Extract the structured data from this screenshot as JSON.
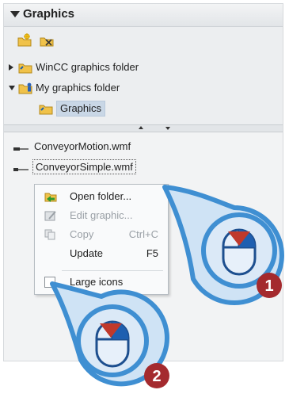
{
  "panel": {
    "title": "Graphics"
  },
  "toolbar": [
    {
      "icon": "new-folder-icon"
    },
    {
      "icon": "delete-folder-icon"
    }
  ],
  "tree": [
    {
      "label": "WinCC graphics folder",
      "expanded": false
    },
    {
      "label": "My graphics folder",
      "expanded": true
    },
    {
      "label": "Graphics",
      "selected": true
    }
  ],
  "files": [
    {
      "name": "ConveyorMotion.wmf"
    },
    {
      "name": "ConveyorSimple.wmf"
    }
  ],
  "context_menu": {
    "items": [
      {
        "label": "Open folder...",
        "shortcut": "",
        "enabled": true,
        "icon": "open-folder-icon"
      },
      {
        "label": "Edit graphic...",
        "shortcut": "",
        "enabled": false,
        "icon": "edit-graphic-icon"
      },
      {
        "label": "Copy",
        "shortcut": "Ctrl+C",
        "enabled": false,
        "icon": "copy-icon"
      },
      {
        "label": "Update",
        "shortcut": "F5",
        "enabled": true,
        "icon": ""
      },
      {
        "label": "Large icons",
        "shortcut": "",
        "enabled": true,
        "icon": "checkbox-icon"
      }
    ]
  },
  "callouts": [
    {
      "number": "1",
      "icon": "mouse-right-click-icon"
    },
    {
      "number": "2",
      "icon": "mouse-right-click-icon"
    }
  ],
  "colors": {
    "callout_blue": "#3f8fd2",
    "mouse_fill": "#dbe9f7",
    "arrow_red": "#c0392b",
    "badge_red": "#a42a2e"
  }
}
